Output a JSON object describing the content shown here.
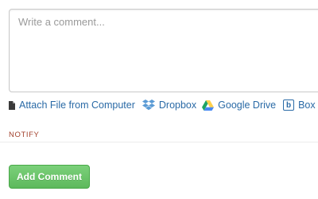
{
  "comment": {
    "placeholder": "Write a comment...",
    "value": ""
  },
  "attachments": [
    {
      "label": "Attach File from Computer",
      "icon": "file-icon"
    },
    {
      "label": "Dropbox",
      "icon": "dropbox-icon"
    },
    {
      "label": "Google Drive",
      "icon": "google-drive-icon"
    },
    {
      "label": "Box",
      "icon": "box-icon"
    }
  ],
  "box_icon_letter": "b",
  "notify": {
    "label": "NOTIFY"
  },
  "submit": {
    "label": "Add Comment"
  },
  "colors": {
    "link": "#2a6aa6",
    "notify": "#a2412c",
    "button": "#5db95c",
    "dropbox": "#5b9bd5",
    "drive_green": "#1fa463",
    "drive_yellow": "#ffd04b",
    "drive_blue": "#4688f4"
  }
}
